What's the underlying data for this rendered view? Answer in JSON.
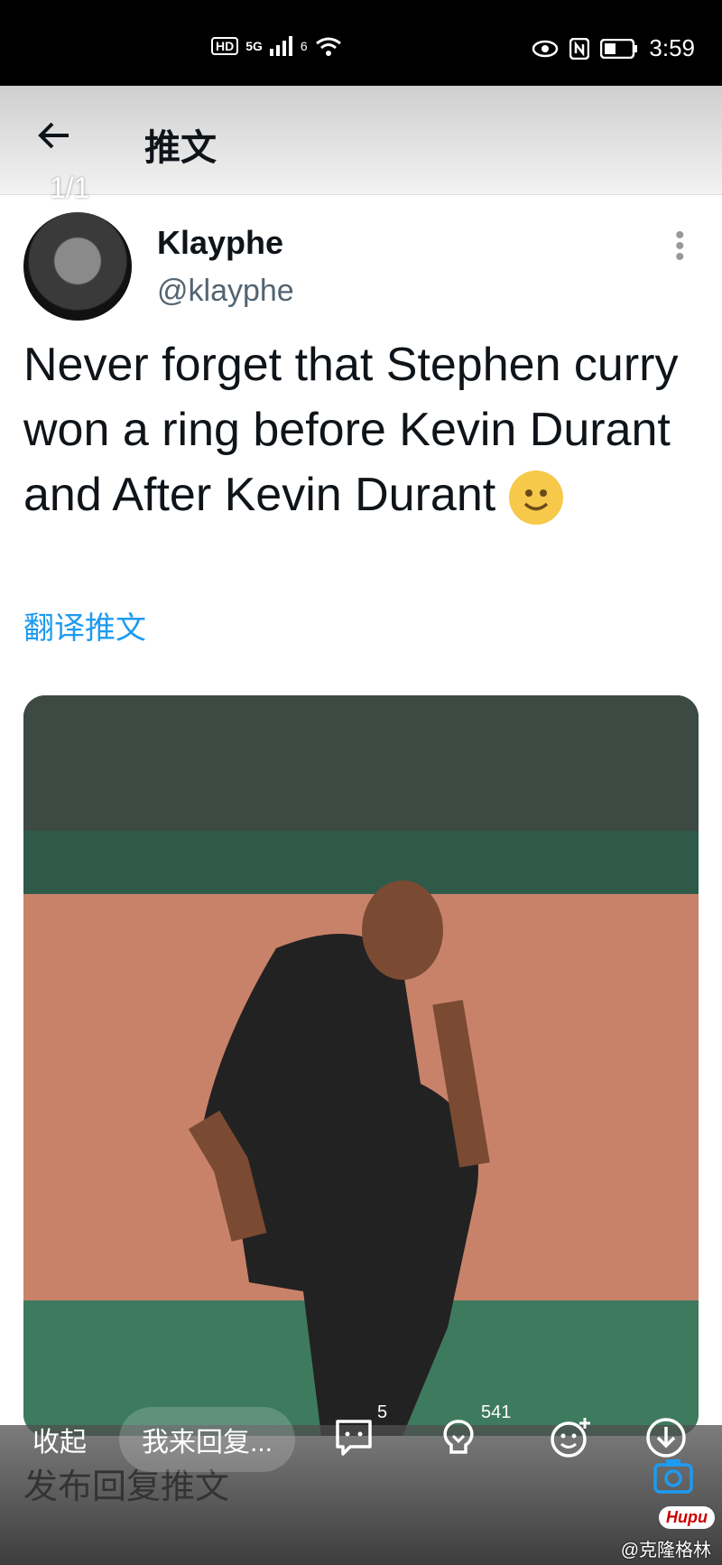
{
  "status_bar": {
    "hd": "HD",
    "network": "5G",
    "wifi_label": "6",
    "time": "3:59"
  },
  "header": {
    "back_icon": "arrow-left-icon",
    "title": "推文",
    "pager": "1/1"
  },
  "tweet": {
    "display_name": "Klayphe",
    "handle": "@klayphe",
    "text": "Never forget that Stephen curry won a ring before Kevin Durant and After Kevin Durant",
    "translate": "翻译推文"
  },
  "bottom_bar": {
    "collapse": "收起",
    "reply_placeholder": "我来回复...",
    "comment_count": "5",
    "like_count": "541",
    "compose_label": "发布回复推文",
    "logo": "Hupu",
    "credit": "@克隆格林"
  },
  "colors": {
    "link": "#1d9bf0",
    "status_bg": "#000000"
  }
}
